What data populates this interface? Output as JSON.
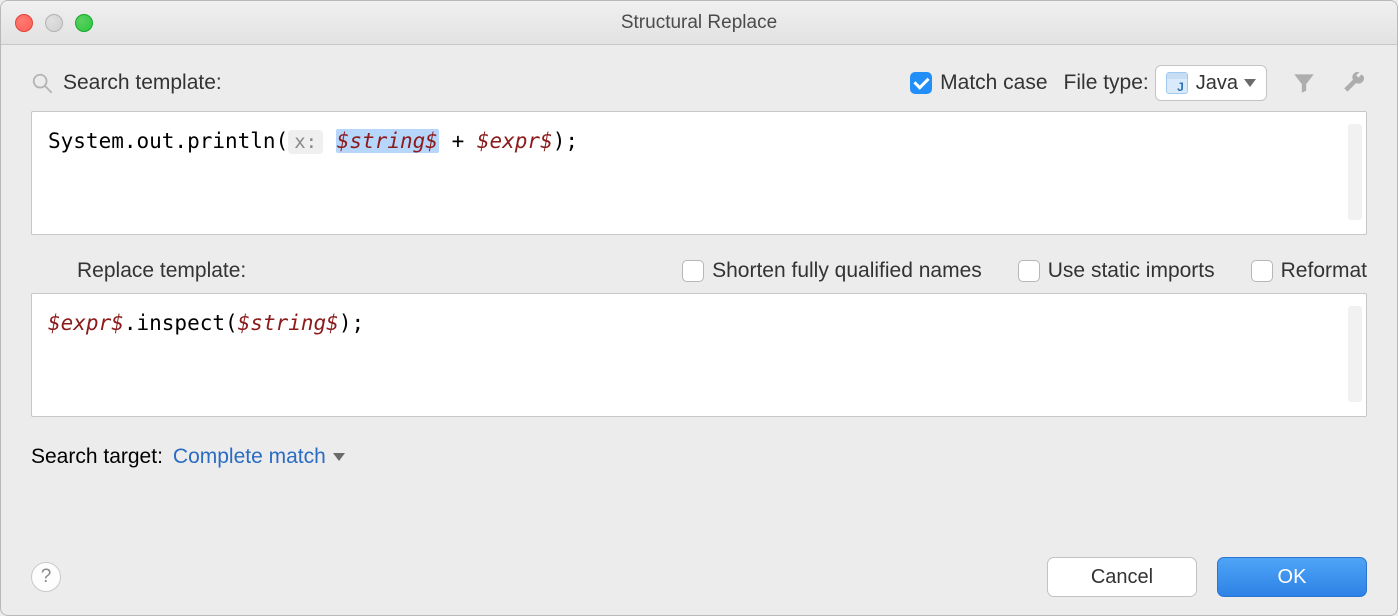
{
  "window": {
    "title": "Structural Replace"
  },
  "search": {
    "label": "Search template:",
    "match_case_label": "Match case",
    "match_case_checked": true,
    "file_type_label": "File type:",
    "file_type_value": "Java",
    "code": {
      "pre": "System.out.println(",
      "hint": "x:",
      "var1": "$string$",
      "mid": " + ",
      "var2": "$expr$",
      "post": ");"
    }
  },
  "replace": {
    "label": "Replace template:",
    "shorten_label": "Shorten fully qualified names",
    "static_imports_label": "Use static imports",
    "reformat_label": "Reformat",
    "code": {
      "var1": "$expr$",
      "mid": ".inspect(",
      "var2": "$string$",
      "post": ");"
    }
  },
  "target": {
    "label": "Search target:",
    "value": "Complete match"
  },
  "footer": {
    "cancel": "Cancel",
    "ok": "OK"
  }
}
